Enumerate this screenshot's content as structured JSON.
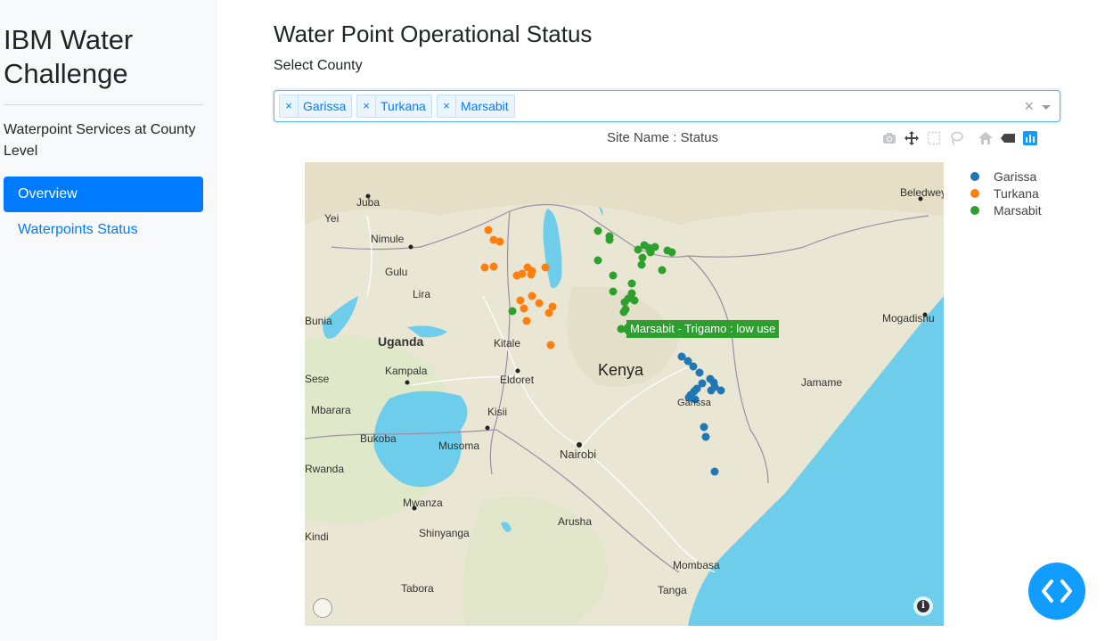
{
  "sidebar": {
    "title": "IBM Water Challenge",
    "lead": "Waterpoint Services at County Level",
    "nav": [
      {
        "label": "Overview",
        "active": true
      },
      {
        "label": "Waterpoints Status",
        "active": false
      }
    ]
  },
  "main": {
    "title": "Water Point Operational Status",
    "select_label": "Select County",
    "selected_counties": [
      "Garissa",
      "Turkana",
      "Marsabit"
    ],
    "clear_symbol": "×",
    "tag_remove_symbol": "×"
  },
  "plot": {
    "title": "Site Name : Status",
    "modebar_icons": [
      "camera-icon",
      "pan-icon",
      "box-select-icon",
      "lasso-icon",
      "home-icon",
      "reset-view-icon",
      "plotly-logo-icon"
    ],
    "legend": [
      {
        "name": "Garissa",
        "color": "#1f77b4"
      },
      {
        "name": "Turkana",
        "color": "#ff7f0e"
      },
      {
        "name": "Marsabit",
        "color": "#2ca02c"
      }
    ],
    "hover_label": "Marsabit - Trigamo : low use",
    "map_labels": {
      "country": "Kenya",
      "cities": [
        "Juba",
        "Yei",
        "Nimule",
        "Gulu",
        "Lira",
        "Uganda",
        "Kitale",
        "Kampala",
        "Eldoret",
        "Kisii",
        "Mbarara",
        "Bukoba",
        "Musoma",
        "Nairobi",
        "Mwanza",
        "Arusha",
        "Shinyanga",
        "Tabora",
        "Mombasa",
        "Tanga",
        "Garissa",
        "Jamame",
        "Mogadishu",
        "Beledweyne",
        "Bunia",
        "Sese",
        "Rwanda",
        "Kindi"
      ]
    }
  },
  "dev_tools_icon": "code-brackets-icon"
}
